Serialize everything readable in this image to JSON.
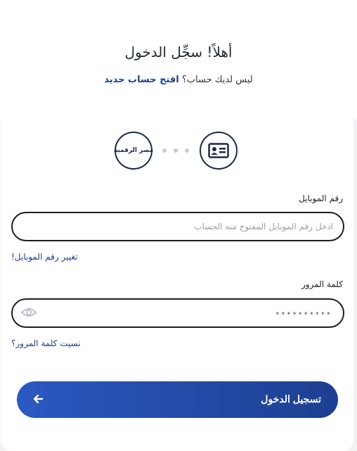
{
  "header": {
    "title": "أهلاً! سجِّل الدخول",
    "subtitle_text": "ليس لديك حساب؟",
    "subtitle_link": "افتح حساب جديد"
  },
  "steps": {
    "logo_text": "مصر الرقمية",
    "id_icon": "id-card-icon"
  },
  "form": {
    "mobile_label": "رقم الموبايل",
    "mobile_placeholder": "ادخل رقم الموبايل المفتوح منه الحساب",
    "mobile_value": "",
    "change_mobile_link": "تغيير رقم الموبايل!",
    "password_label": "كلمة المرور",
    "password_mask": "••••••••••",
    "forgot_password_link": "نسيت كلمة المرور؟",
    "submit_label": "تسجيل الدخول",
    "submit_icon": "arrow-left-icon",
    "eye_icon": "eye-icon"
  },
  "colors": {
    "accent": "#1e3f86",
    "button_gradient_start": "#2a59c2",
    "button_gradient_end": "#1e3f91",
    "border": "#1b1e24"
  }
}
